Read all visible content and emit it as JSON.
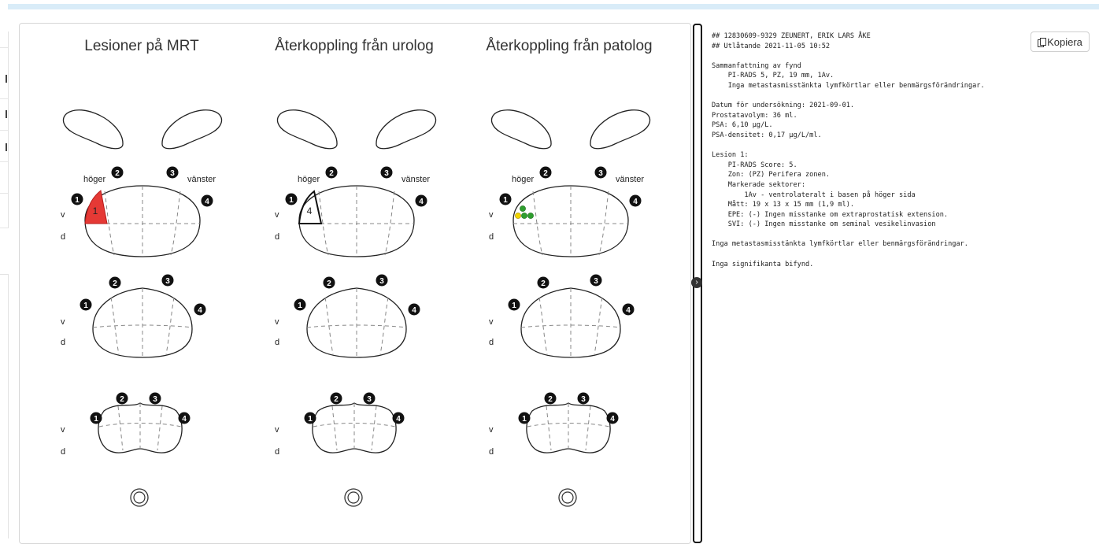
{
  "titles": {
    "mrt": "Lesioner på MRT",
    "urolog": "Återkoppling från urolog",
    "patolog": "Återkoppling från patolog"
  },
  "side_labels": {
    "right": "höger",
    "left": "vänster",
    "ventral": "v",
    "dorsal": "d"
  },
  "sector_numbers": [
    "1",
    "2",
    "3",
    "4"
  ],
  "mrt_lesion_label": "1",
  "urolog_lesion_label": "4",
  "colors": {
    "mrt_lesion": "#e53935",
    "patolog_dots_green": "#2e9e2e",
    "patolog_dot_yellow": "#f2d500",
    "accent_strip": "#d9ecf8"
  },
  "copy_button": {
    "label": "Kopiera",
    "icon": "copy-icon"
  },
  "divider_toggle_icon": "chevron-right-icon",
  "report": {
    "lines": [
      "## 12830609-9329 ZEUNERT, ERIK LARS ÅKE",
      "## Utlåtande 2021-11-05 10:52",
      "",
      "Sammanfattning av fynd",
      "    PI-RADS 5, PZ, 19 mm, 1Av.",
      "    Inga metastasmisstänkta lymfkörtlar eller benmärgsförändringar.",
      "",
      "Datum för undersökning: 2021-09-01.",
      "Prostatavolym: 36 ml.",
      "PSA: 6,10 µg/L.",
      "PSA-densitet: 0,17 µg/L/ml.",
      "",
      "Lesion 1:",
      "    PI-RADS Score: 5.",
      "    Zon: (PZ) Perifera zonen.",
      "    Markerade sektorer:",
      "        1Av - ventrolateralt i basen på höger sida",
      "    Mått: 19 x 13 x 15 mm (1,9 ml).",
      "    EPE: (-) Ingen misstanke om extraprostatisk extension.",
      "    SVI: (-) Ingen misstanke om seminal vesikelinvasion",
      "",
      "Inga metastasmisstänkta lymfkörtlar eller benmärgsförändringar.",
      "",
      "Inga signifikanta bifynd."
    ]
  }
}
